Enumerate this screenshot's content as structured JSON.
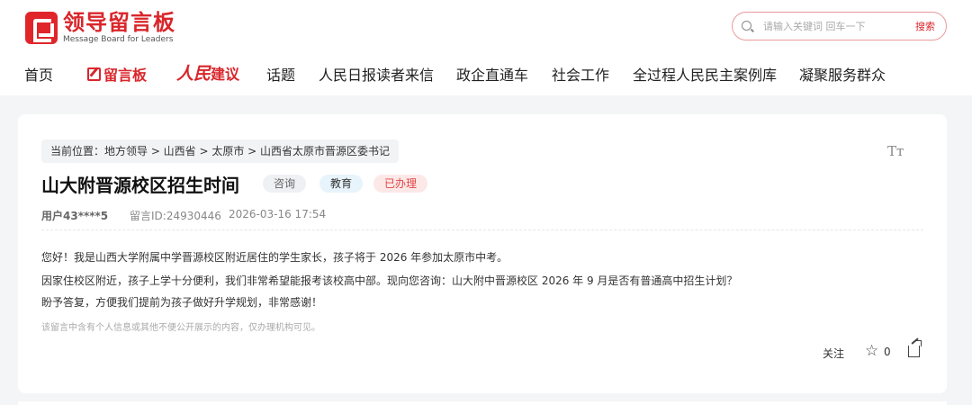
{
  "header": {
    "logo_title": "领导留言板",
    "logo_subtitle": "Message Board for Leaders",
    "search_placeholder": "请输入关键词 回车一下",
    "search_button": "搜索"
  },
  "nav": {
    "home": "首页",
    "board": "留言板",
    "rm_brand": "人民",
    "rm_tail": "建议",
    "topics": "话题",
    "letters": "人民日报读者来信",
    "business": "政企直通车",
    "social": "社会工作",
    "democracy": "全过程人民民主案例库",
    "service": "凝聚服务群众"
  },
  "breadcrumb": "当前位置：地方领导 > 山西省 > 太原市 > 山西省太原市晋源区委书记",
  "text_size_icon": "Tт",
  "message": {
    "title": "山大附晋源校区招生时间",
    "tags": [
      "咨询",
      "教育",
      "已办理"
    ],
    "user": "用户43****5",
    "message_id": "留言ID:24930446",
    "datetime": "2026-03-16 17:54",
    "body": [
      "您好！我是山西大学附属中学晋源校区附近居住的学生家长，孩子将于 2026 年参加太原市中考。",
      "因家住校区附近，孩子上学十分便利，我们非常希望能报考该校高中部。现向您咨询：山大附中晋源校区 2026 年 9 月是否有普通高中招生计划？",
      "盼予答复，方便我们提前为孩子做好升学规划，非常感谢！"
    ],
    "privacy_notice": "该留言中含有个人信息或其他不便公开展示的内容，仅办理机构可见。"
  },
  "actions": {
    "follow": "关注",
    "star_count": "0"
  }
}
